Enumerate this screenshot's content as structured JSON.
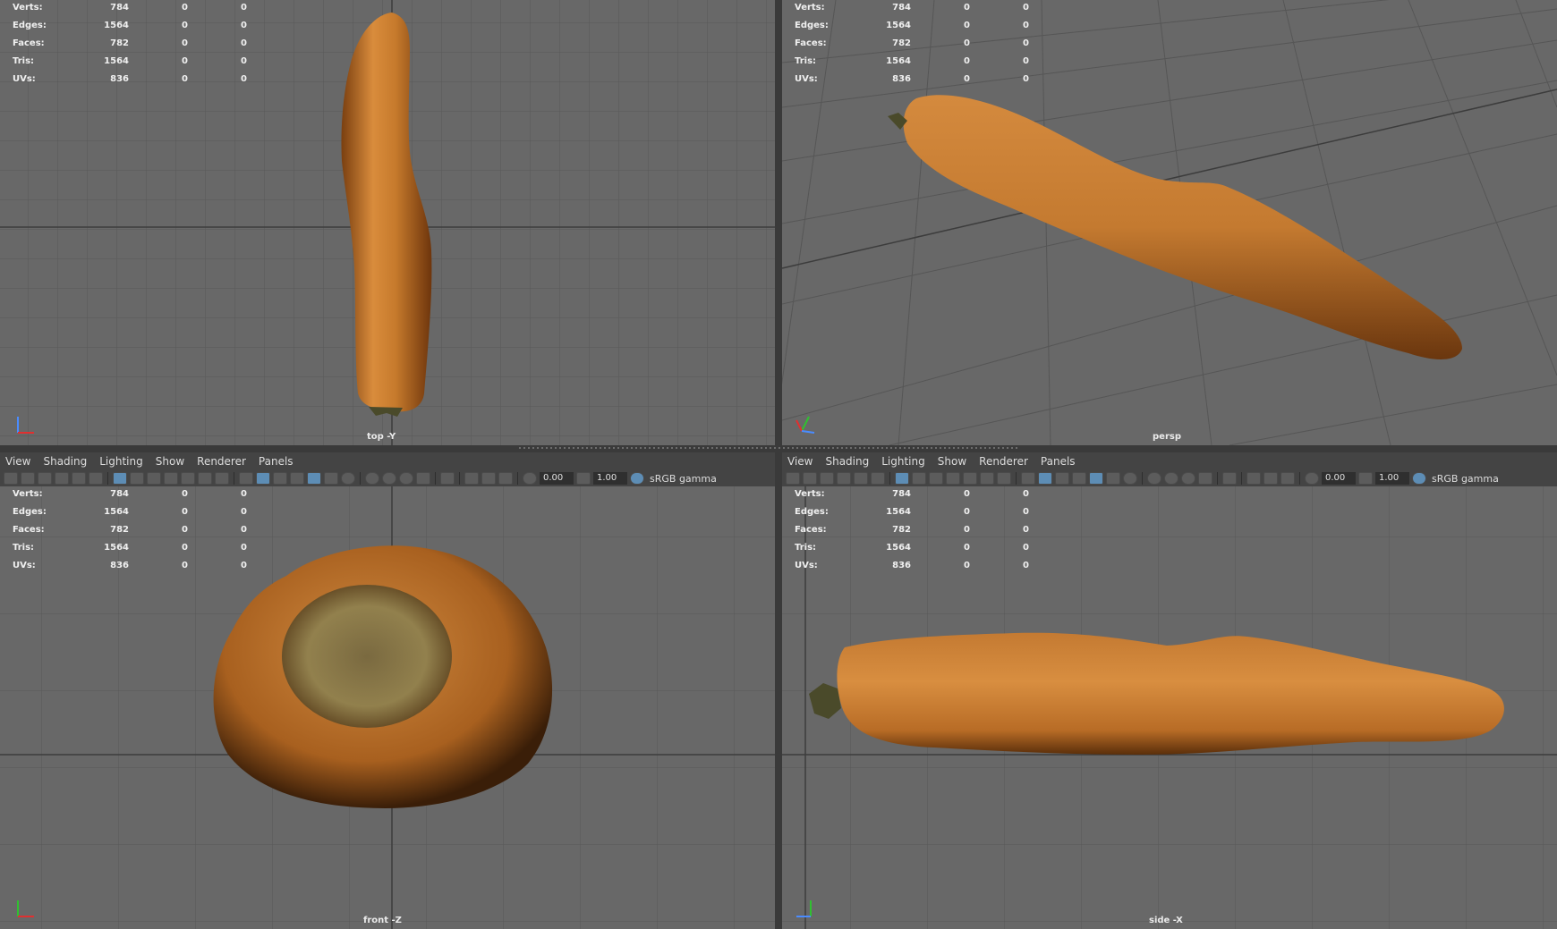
{
  "stats": {
    "labels": [
      "Verts:",
      "Edges:",
      "Faces:",
      "Tris:",
      "UVs:"
    ],
    "col1": [
      "784",
      "1564",
      "782",
      "1564",
      "836"
    ],
    "col2": [
      "0",
      "0",
      "0",
      "0",
      "0"
    ],
    "col3": [
      "0",
      "0",
      "0",
      "0",
      "0"
    ]
  },
  "viewports": {
    "top": {
      "camera": "top -Y"
    },
    "persp": {
      "camera": "persp"
    },
    "front": {
      "camera": "front -Z"
    },
    "side": {
      "camera": "side -X"
    }
  },
  "panel_menu": [
    "View",
    "Shading",
    "Lighting",
    "Show",
    "Renderer",
    "Panels"
  ],
  "panel_toolbar": {
    "exposure": "0.00",
    "gamma_value": "1.00",
    "color_space": "sRGB gamma"
  },
  "icons": [
    "camera-icon",
    "select-camera-icon",
    "bookmark-icon",
    "image-plane-icon",
    "grid-icon",
    "film-gate-icon",
    "wireframe-icon",
    "smooth-shade-icon",
    "textured-icon",
    "lighting-icon",
    "shadows-icon",
    "isolate-icon",
    "xray-icon",
    "exposure-icon",
    "gamma-icon",
    "color-management-icon"
  ],
  "colors": {
    "viewport_bg": "#686868",
    "grid_line": "#555555",
    "grid_axis": "#3c3c3c",
    "carrot": "#c27830",
    "toolbar_bg": "#444444",
    "highlight": "#5d8db5"
  }
}
